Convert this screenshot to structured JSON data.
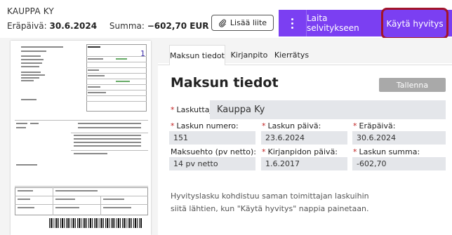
{
  "header": {
    "company": "KAUPPA KY",
    "due_label": "Eräpäivä:",
    "due_value": "30.6.2024",
    "sum_label": "Summa:",
    "sum_value": "−602,70 EUR",
    "attach_label": "Lisää liite",
    "send_label": "Laita selvitykseen",
    "credit_label": "Käytä hyvitys",
    "purple_color": "#7b3ff2",
    "highlight_color": "#a2142a"
  },
  "preview": {
    "page_number": "1"
  },
  "tabs": [
    {
      "label": "Maksun tiedot"
    },
    {
      "label": "Kirjanpito"
    },
    {
      "label": "Kierrätys"
    }
  ],
  "form": {
    "title": "Maksun tiedot",
    "save_label": "Tallenna",
    "payee_label": "Laskuttaja:",
    "payee_value": "Kauppa Ky",
    "invoice_number_label": "Laskun numero:",
    "invoice_number_value": "151",
    "invoice_date_label": "Laskun päivä:",
    "invoice_date_value": "23.6.2024",
    "due_date_label": "Eräpäivä:",
    "due_date_value": "30.6.2024",
    "terms_label": "Maksuehto (pv netto):",
    "terms_value": "14 pv netto",
    "book_date_label": "Kirjanpidon päivä:",
    "book_date_value": "1.6.2017",
    "amount_label": "Laskun summa:",
    "amount_value": "-602,70",
    "required_mark": "*"
  },
  "info_text": "Hyvityslasku kohdistuu saman toimittajan laskuihin siitä lähtien, kun \"Käytä hyvitys\" nappia painetaan."
}
